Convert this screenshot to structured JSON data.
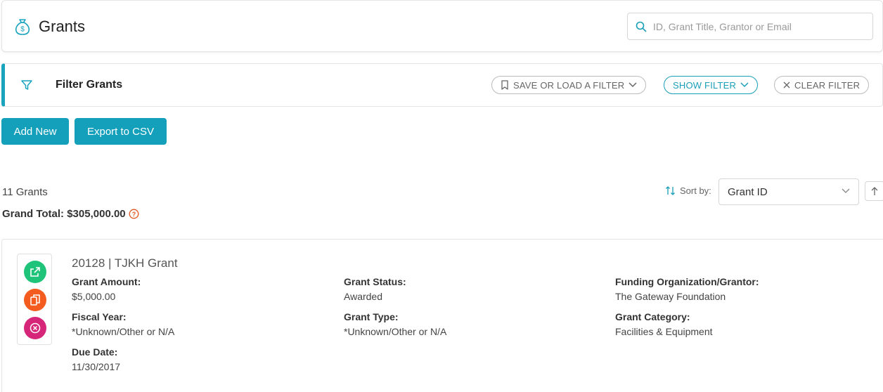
{
  "header": {
    "title": "Grants",
    "search_placeholder": "ID, Grant Title, Grantor or Email"
  },
  "filter": {
    "title": "Filter Grants",
    "save_load_label": "SAVE OR LOAD A FILTER",
    "show_label": "SHOW FILTER",
    "clear_label": "CLEAR FILTER"
  },
  "toolbar": {
    "add_label": "Add New",
    "export_label": "Export to CSV"
  },
  "summary": {
    "count": "11 Grants",
    "grand_total": "Grand Total: $305,000.00"
  },
  "sort": {
    "label": "Sort by:",
    "value": "Grant ID"
  },
  "grant": {
    "title": "20128 | TJKH Grant",
    "fields": [
      {
        "label": "Grant Amount:",
        "value": "$5,000.00"
      },
      {
        "label": "Fiscal Year:",
        "value": "*Unknown/Other or N/A"
      },
      {
        "label": "Due Date:",
        "value": "11/30/2017"
      },
      {
        "label": "Grant Status:",
        "value": "Awarded"
      },
      {
        "label": "Grant Type:",
        "value": "*Unknown/Other or N/A"
      },
      {
        "label": "Funding Organization/Grantor:",
        "value": "The Gateway Foundation"
      },
      {
        "label": "Grant Category:",
        "value": "Facilities & Equipment"
      }
    ]
  },
  "colors": {
    "accent": "#14a0bb",
    "open": "#1fc47a",
    "copy": "#f35b1f",
    "delete": "#d6267a"
  },
  "icons": [
    "money-bag-icon",
    "search-icon",
    "filter-icon",
    "bookmark-icon",
    "chevron-down-icon",
    "close-icon",
    "sort-icon",
    "question-icon",
    "arrow-up-icon",
    "external-link-icon",
    "copy-icon",
    "delete-icon"
  ]
}
